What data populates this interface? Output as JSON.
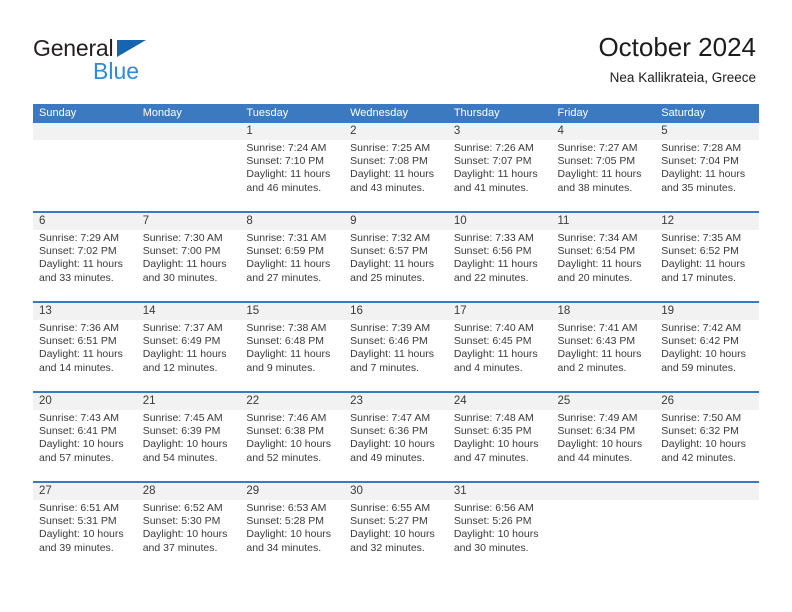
{
  "logo": {
    "word1": "General",
    "word2": "Blue",
    "triangle_color": "#1565b0",
    "word2_color": "#2e8bd8"
  },
  "header": {
    "title": "October 2024",
    "subtitle": "Nea Kallikrateia, Greece"
  },
  "theme": {
    "header_blue": "#3b7ac0",
    "daynum_band": "#f2f2f2",
    "text": "#3a3a3a"
  },
  "calendar": {
    "day_headers": [
      "Sunday",
      "Monday",
      "Tuesday",
      "Wednesday",
      "Thursday",
      "Friday",
      "Saturday"
    ],
    "weeks": [
      [
        {
          "day": "",
          "sunrise": "",
          "sunset": "",
          "daylight_line1": "",
          "daylight_line2": ""
        },
        {
          "day": "",
          "sunrise": "",
          "sunset": "",
          "daylight_line1": "",
          "daylight_line2": ""
        },
        {
          "day": "1",
          "sunrise": "Sunrise: 7:24 AM",
          "sunset": "Sunset: 7:10 PM",
          "daylight_line1": "Daylight: 11 hours",
          "daylight_line2": "and 46 minutes."
        },
        {
          "day": "2",
          "sunrise": "Sunrise: 7:25 AM",
          "sunset": "Sunset: 7:08 PM",
          "daylight_line1": "Daylight: 11 hours",
          "daylight_line2": "and 43 minutes."
        },
        {
          "day": "3",
          "sunrise": "Sunrise: 7:26 AM",
          "sunset": "Sunset: 7:07 PM",
          "daylight_line1": "Daylight: 11 hours",
          "daylight_line2": "and 41 minutes."
        },
        {
          "day": "4",
          "sunrise": "Sunrise: 7:27 AM",
          "sunset": "Sunset: 7:05 PM",
          "daylight_line1": "Daylight: 11 hours",
          "daylight_line2": "and 38 minutes."
        },
        {
          "day": "5",
          "sunrise": "Sunrise: 7:28 AM",
          "sunset": "Sunset: 7:04 PM",
          "daylight_line1": "Daylight: 11 hours",
          "daylight_line2": "and 35 minutes."
        }
      ],
      [
        {
          "day": "6",
          "sunrise": "Sunrise: 7:29 AM",
          "sunset": "Sunset: 7:02 PM",
          "daylight_line1": "Daylight: 11 hours",
          "daylight_line2": "and 33 minutes."
        },
        {
          "day": "7",
          "sunrise": "Sunrise: 7:30 AM",
          "sunset": "Sunset: 7:00 PM",
          "daylight_line1": "Daylight: 11 hours",
          "daylight_line2": "and 30 minutes."
        },
        {
          "day": "8",
          "sunrise": "Sunrise: 7:31 AM",
          "sunset": "Sunset: 6:59 PM",
          "daylight_line1": "Daylight: 11 hours",
          "daylight_line2": "and 27 minutes."
        },
        {
          "day": "9",
          "sunrise": "Sunrise: 7:32 AM",
          "sunset": "Sunset: 6:57 PM",
          "daylight_line1": "Daylight: 11 hours",
          "daylight_line2": "and 25 minutes."
        },
        {
          "day": "10",
          "sunrise": "Sunrise: 7:33 AM",
          "sunset": "Sunset: 6:56 PM",
          "daylight_line1": "Daylight: 11 hours",
          "daylight_line2": "and 22 minutes."
        },
        {
          "day": "11",
          "sunrise": "Sunrise: 7:34 AM",
          "sunset": "Sunset: 6:54 PM",
          "daylight_line1": "Daylight: 11 hours",
          "daylight_line2": "and 20 minutes."
        },
        {
          "day": "12",
          "sunrise": "Sunrise: 7:35 AM",
          "sunset": "Sunset: 6:52 PM",
          "daylight_line1": "Daylight: 11 hours",
          "daylight_line2": "and 17 minutes."
        }
      ],
      [
        {
          "day": "13",
          "sunrise": "Sunrise: 7:36 AM",
          "sunset": "Sunset: 6:51 PM",
          "daylight_line1": "Daylight: 11 hours",
          "daylight_line2": "and 14 minutes."
        },
        {
          "day": "14",
          "sunrise": "Sunrise: 7:37 AM",
          "sunset": "Sunset: 6:49 PM",
          "daylight_line1": "Daylight: 11 hours",
          "daylight_line2": "and 12 minutes."
        },
        {
          "day": "15",
          "sunrise": "Sunrise: 7:38 AM",
          "sunset": "Sunset: 6:48 PM",
          "daylight_line1": "Daylight: 11 hours",
          "daylight_line2": "and 9 minutes."
        },
        {
          "day": "16",
          "sunrise": "Sunrise: 7:39 AM",
          "sunset": "Sunset: 6:46 PM",
          "daylight_line1": "Daylight: 11 hours",
          "daylight_line2": "and 7 minutes."
        },
        {
          "day": "17",
          "sunrise": "Sunrise: 7:40 AM",
          "sunset": "Sunset: 6:45 PM",
          "daylight_line1": "Daylight: 11 hours",
          "daylight_line2": "and 4 minutes."
        },
        {
          "day": "18",
          "sunrise": "Sunrise: 7:41 AM",
          "sunset": "Sunset: 6:43 PM",
          "daylight_line1": "Daylight: 11 hours",
          "daylight_line2": "and 2 minutes."
        },
        {
          "day": "19",
          "sunrise": "Sunrise: 7:42 AM",
          "sunset": "Sunset: 6:42 PM",
          "daylight_line1": "Daylight: 10 hours",
          "daylight_line2": "and 59 minutes."
        }
      ],
      [
        {
          "day": "20",
          "sunrise": "Sunrise: 7:43 AM",
          "sunset": "Sunset: 6:41 PM",
          "daylight_line1": "Daylight: 10 hours",
          "daylight_line2": "and 57 minutes."
        },
        {
          "day": "21",
          "sunrise": "Sunrise: 7:45 AM",
          "sunset": "Sunset: 6:39 PM",
          "daylight_line1": "Daylight: 10 hours",
          "daylight_line2": "and 54 minutes."
        },
        {
          "day": "22",
          "sunrise": "Sunrise: 7:46 AM",
          "sunset": "Sunset: 6:38 PM",
          "daylight_line1": "Daylight: 10 hours",
          "daylight_line2": "and 52 minutes."
        },
        {
          "day": "23",
          "sunrise": "Sunrise: 7:47 AM",
          "sunset": "Sunset: 6:36 PM",
          "daylight_line1": "Daylight: 10 hours",
          "daylight_line2": "and 49 minutes."
        },
        {
          "day": "24",
          "sunrise": "Sunrise: 7:48 AM",
          "sunset": "Sunset: 6:35 PM",
          "daylight_line1": "Daylight: 10 hours",
          "daylight_line2": "and 47 minutes."
        },
        {
          "day": "25",
          "sunrise": "Sunrise: 7:49 AM",
          "sunset": "Sunset: 6:34 PM",
          "daylight_line1": "Daylight: 10 hours",
          "daylight_line2": "and 44 minutes."
        },
        {
          "day": "26",
          "sunrise": "Sunrise: 7:50 AM",
          "sunset": "Sunset: 6:32 PM",
          "daylight_line1": "Daylight: 10 hours",
          "daylight_line2": "and 42 minutes."
        }
      ],
      [
        {
          "day": "27",
          "sunrise": "Sunrise: 6:51 AM",
          "sunset": "Sunset: 5:31 PM",
          "daylight_line1": "Daylight: 10 hours",
          "daylight_line2": "and 39 minutes."
        },
        {
          "day": "28",
          "sunrise": "Sunrise: 6:52 AM",
          "sunset": "Sunset: 5:30 PM",
          "daylight_line1": "Daylight: 10 hours",
          "daylight_line2": "and 37 minutes."
        },
        {
          "day": "29",
          "sunrise": "Sunrise: 6:53 AM",
          "sunset": "Sunset: 5:28 PM",
          "daylight_line1": "Daylight: 10 hours",
          "daylight_line2": "and 34 minutes."
        },
        {
          "day": "30",
          "sunrise": "Sunrise: 6:55 AM",
          "sunset": "Sunset: 5:27 PM",
          "daylight_line1": "Daylight: 10 hours",
          "daylight_line2": "and 32 minutes."
        },
        {
          "day": "31",
          "sunrise": "Sunrise: 6:56 AM",
          "sunset": "Sunset: 5:26 PM",
          "daylight_line1": "Daylight: 10 hours",
          "daylight_line2": "and 30 minutes."
        },
        {
          "day": "",
          "sunrise": "",
          "sunset": "",
          "daylight_line1": "",
          "daylight_line2": ""
        },
        {
          "day": "",
          "sunrise": "",
          "sunset": "",
          "daylight_line1": "",
          "daylight_line2": ""
        }
      ]
    ]
  }
}
